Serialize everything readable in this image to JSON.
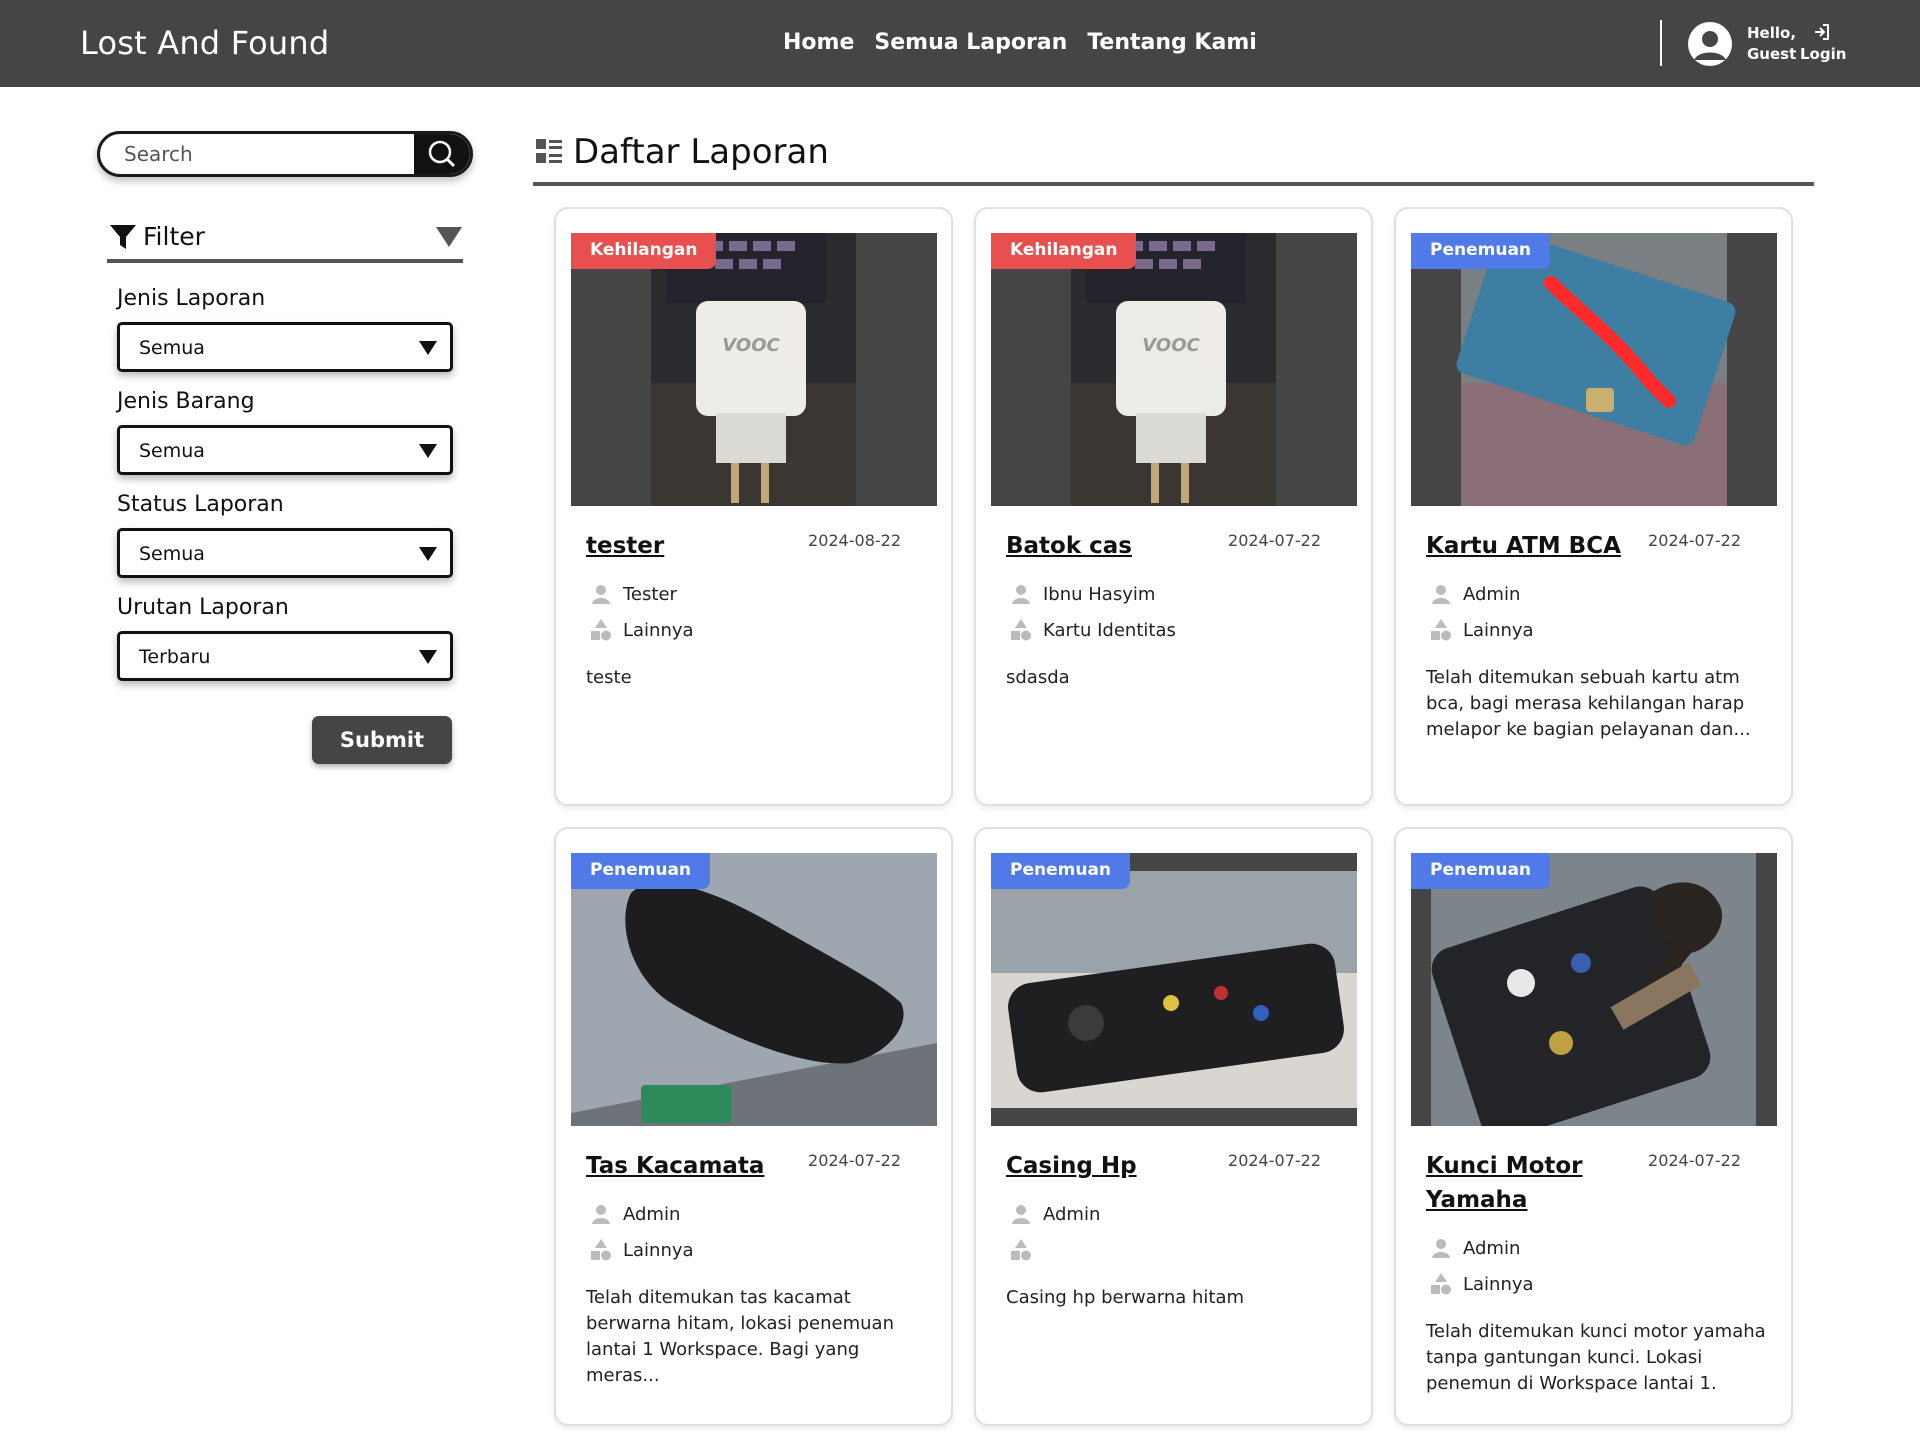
{
  "navbar": {
    "brand": "Lost And Found",
    "links": [
      "Home",
      "Semua Laporan",
      "Tentang Kami"
    ],
    "greeting_line1": "Hello,",
    "greeting_line2": "Guest",
    "login_label": "Login"
  },
  "sidebar": {
    "search_placeholder": "Search",
    "filter_title": "Filter",
    "fields": [
      {
        "label": "Jenis Laporan",
        "value": "Semua"
      },
      {
        "label": "Jenis Barang",
        "value": "Semua"
      },
      {
        "label": "Status Laporan",
        "value": "Semua"
      },
      {
        "label": "Urutan Laporan",
        "value": "Terbaru"
      }
    ],
    "submit_label": "Submit"
  },
  "main": {
    "title": "Daftar Laporan",
    "cards": [
      {
        "badge": "Kehilangan",
        "title": "tester",
        "date": "2024-08-22",
        "reporter": "Tester",
        "category": "Lainnya",
        "description": "teste",
        "photo": "charger"
      },
      {
        "badge": "Kehilangan",
        "title": "Batok cas",
        "date": "2024-07-22",
        "reporter": "Ibnu Hasyim",
        "category": "Kartu Identitas",
        "description": "sdasda",
        "photo": "charger"
      },
      {
        "badge": "Penemuan",
        "title": "Kartu ATM BCA",
        "date": "2024-07-22",
        "reporter": "Admin",
        "category": "Lainnya",
        "description": "Telah ditemukan sebuah kartu atm bca, bagi merasa kehilangan harap melapor ke bagian pelayanan dan...",
        "photo": "card"
      },
      {
        "badge": "Penemuan",
        "title": "Tas Kacamata",
        "date": "2024-07-22",
        "reporter": "Admin",
        "category": "Lainnya",
        "description": "Telah ditemukan tas kacamat berwarna hitam, lokasi penemuan lantai 1 Workspace. Bagi yang meras...",
        "photo": "case"
      },
      {
        "badge": "Penemuan",
        "title": "Casing Hp",
        "date": "2024-07-22",
        "reporter": "Admin",
        "category": "",
        "description": "Casing hp berwarna hitam",
        "photo": "phone"
      },
      {
        "badge": "Penemuan",
        "title": "Kunci Motor Yamaha",
        "date": "2024-07-22",
        "reporter": "Admin",
        "category": "Lainnya",
        "description": "Telah ditemukan kunci motor yamaha tanpa gantungan kunci. Lokasi penemun di Workspace lantai 1.",
        "photo": "keys"
      }
    ]
  },
  "colors": {
    "navbar": "#454545",
    "badge_kehilangan": "#e8504f",
    "badge_penemuan": "#4f7ae8"
  },
  "icons": [
    "search-icon",
    "filter-icon",
    "triangle-down-icon",
    "list-icon",
    "user-avatar-icon",
    "login-icon",
    "person-icon",
    "shapes-icon"
  ]
}
